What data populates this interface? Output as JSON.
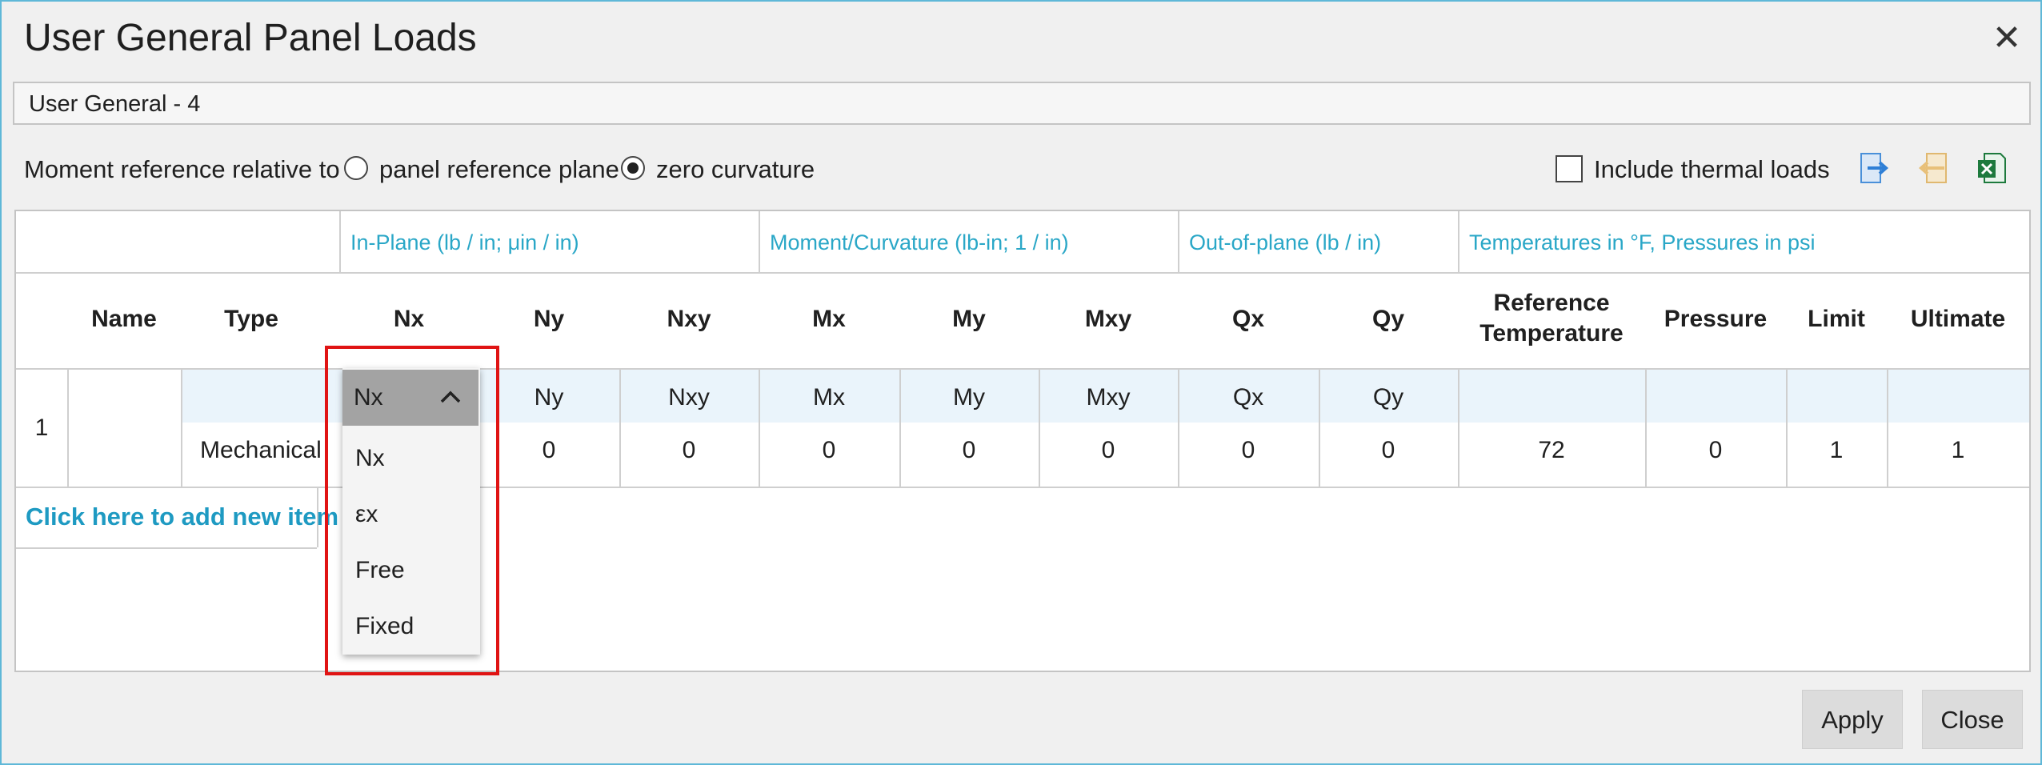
{
  "dialog": {
    "title": "User General Panel Loads",
    "close_glyph": "✕",
    "name_value": "User General - 4"
  },
  "options": {
    "moment_label": "Moment reference relative to",
    "radio_panel_label": "panel reference plane",
    "radio_zero_label": "zero curvature",
    "selected_radio": "zero curvature",
    "thermal_label": "Include thermal loads",
    "thermal_checked": false,
    "icons": [
      "export-icon",
      "import-icon",
      "excel-icon"
    ]
  },
  "grid": {
    "groups": [
      "In-Plane (lb / in; μin / in)",
      "Moment/Curvature (lb-in; 1 / in)",
      "Out-of-plane (lb / in)",
      "Temperatures in °F, Pressures in psi"
    ],
    "columns": {
      "name": "Name",
      "type": "Type",
      "nx": "Nx",
      "ny": "Ny",
      "nxy": "Nxy",
      "mx": "Mx",
      "my": "My",
      "mxy": "Mxy",
      "qx": "Qx",
      "qy": "Qy",
      "ref_temp_1": "Reference",
      "ref_temp_2": "Temperature",
      "pressure": "Pressure",
      "limit": "Limit",
      "ultimate": "Ultimate"
    },
    "row": {
      "index": "1",
      "type": "Mechanical",
      "modes": {
        "ny": "Ny",
        "nxy": "Nxy",
        "mx": "Mx",
        "my": "My",
        "mxy": "Mxy",
        "qx": "Qx",
        "qy": "Qy"
      },
      "values": {
        "ny": "0",
        "nxy": "0",
        "mx": "0",
        "my": "0",
        "mxy": "0",
        "qx": "0",
        "qy": "0",
        "ref_temp": "72",
        "pressure": "0",
        "limit": "1",
        "ultimate": "1"
      }
    },
    "add_item": "Click here to add new item"
  },
  "dropdown": {
    "selected": "Nx",
    "options": [
      "Nx",
      "εx",
      "Free",
      "Fixed"
    ]
  },
  "buttons": {
    "apply": "Apply",
    "close": "Close"
  },
  "colors": {
    "accent": "#2aa7c7",
    "highlight": "#e01414",
    "dialog_border": "#5fb8d8"
  }
}
